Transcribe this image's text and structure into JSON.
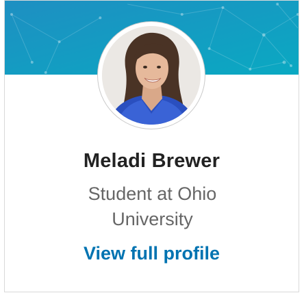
{
  "profile": {
    "name": "Meladi Brewer",
    "headline": "Student at Ohio University",
    "view_link": "View full profile"
  },
  "colors": {
    "banner_top": "#1e8fc2",
    "banner_bottom": "#0aa9c2",
    "link": "#0073b1",
    "name": "#222222",
    "headline": "#666666"
  },
  "icons": {
    "banner": "network-pattern",
    "avatar": "profile-photo"
  }
}
